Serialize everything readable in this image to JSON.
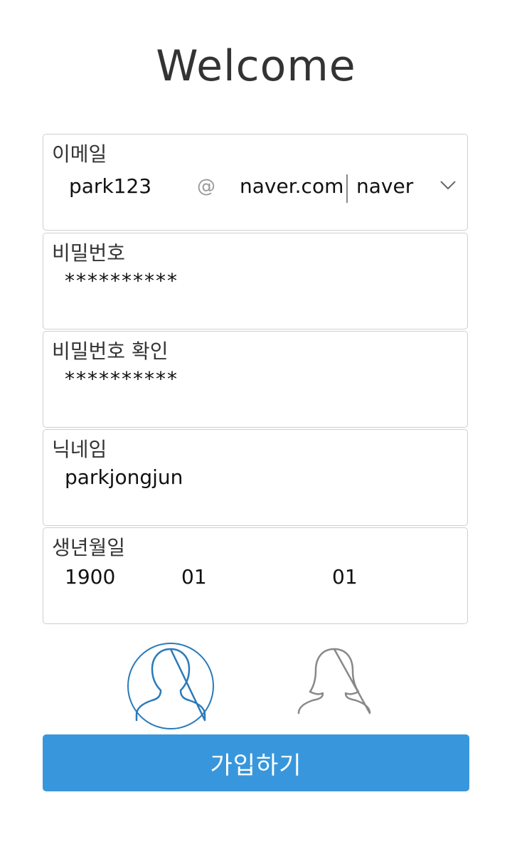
{
  "page": {
    "title": "Welcome"
  },
  "email": {
    "label": "이메일",
    "local_value": "park123",
    "at_symbol": "@",
    "domain_value": "naver.com",
    "domain_select": "naver",
    "select_icon": "chevron-down-icon"
  },
  "password": {
    "label": "비밀번호",
    "value": "**********"
  },
  "password_confirm": {
    "label": "비밀번호 확인",
    "value": "**********"
  },
  "nickname": {
    "label": "닉네임",
    "value": "parkjongjun"
  },
  "birthdate": {
    "label": "생년월일",
    "year": "1900",
    "month": "01",
    "day": "01"
  },
  "gender": {
    "male_icon": "male-user-icon",
    "female_icon": "female-user-icon",
    "selected": "male",
    "selected_color": "#2a7ab8",
    "unselected_color": "#888888"
  },
  "submit": {
    "label": "가입하기",
    "color": "#3897dc"
  }
}
